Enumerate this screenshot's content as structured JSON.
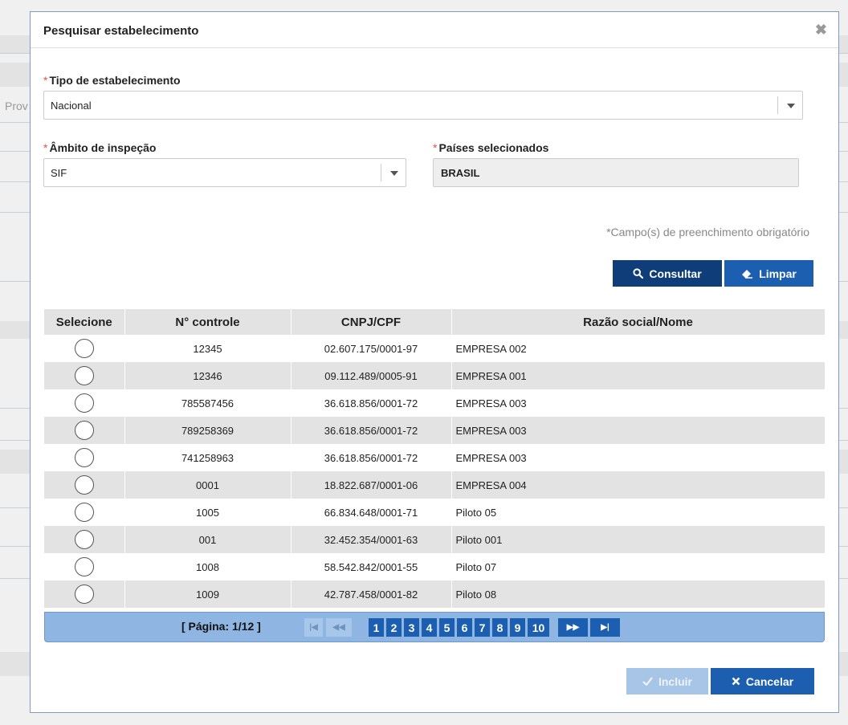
{
  "background": {
    "partial_label": "Prov"
  },
  "modal": {
    "title": "Pesquisar estabelecimento",
    "close_symbol": "✖"
  },
  "form": {
    "required_mark": "*",
    "tipo": {
      "label": "Tipo de estabelecimento",
      "value": "Nacional"
    },
    "ambito": {
      "label": "Âmbito de inspeção",
      "value": "SIF"
    },
    "paises": {
      "label": "Países selecionados",
      "value": "BRASIL"
    },
    "hint": "*Campo(s) de preenchimento obrigatório"
  },
  "buttons": {
    "consultar": "Consultar",
    "limpar": "Limpar",
    "incluir": "Incluir",
    "cancelar": "Cancelar"
  },
  "table": {
    "headers": [
      "Selecione",
      "N° controle",
      "CNPJ/CPF",
      "Razão social/Nome"
    ],
    "rows": [
      {
        "controle": "12345",
        "cnpj": "02.607.175/0001-97",
        "nome": "EMPRESA 002"
      },
      {
        "controle": "12346",
        "cnpj": "09.112.489/0005-91",
        "nome": "EMPRESA 001"
      },
      {
        "controle": "785587456",
        "cnpj": "36.618.856/0001-72",
        "nome": "EMPRESA 003"
      },
      {
        "controle": "789258369",
        "cnpj": "36.618.856/0001-72",
        "nome": "EMPRESA 003"
      },
      {
        "controle": "741258963",
        "cnpj": "36.618.856/0001-72",
        "nome": "EMPRESA 003"
      },
      {
        "controle": "0001",
        "cnpj": "18.822.687/0001-06",
        "nome": "EMPRESA 004"
      },
      {
        "controle": "1005",
        "cnpj": "66.834.648/0001-71",
        "nome": "Piloto 05"
      },
      {
        "controle": "001",
        "cnpj": "32.452.354/0001-63",
        "nome": "Piloto 001"
      },
      {
        "controle": "1008",
        "cnpj": "58.542.842/0001-55",
        "nome": "Piloto 07"
      },
      {
        "controle": "1009",
        "cnpj": "42.787.458/0001-82",
        "nome": "Piloto 08"
      }
    ]
  },
  "pagination": {
    "info": "[ Página: 1/12 ]",
    "first": "|◀",
    "prev": "◀◀",
    "pages": [
      "1",
      "2",
      "3",
      "4",
      "5",
      "6",
      "7",
      "8",
      "9",
      "10"
    ],
    "next": "▶▶",
    "last": "▶|"
  },
  "colors": {
    "primary": "#1c5fb0",
    "primary_dark": "#0e3d79",
    "pager_bg": "#8fb6e3",
    "required": "#d9534f"
  }
}
